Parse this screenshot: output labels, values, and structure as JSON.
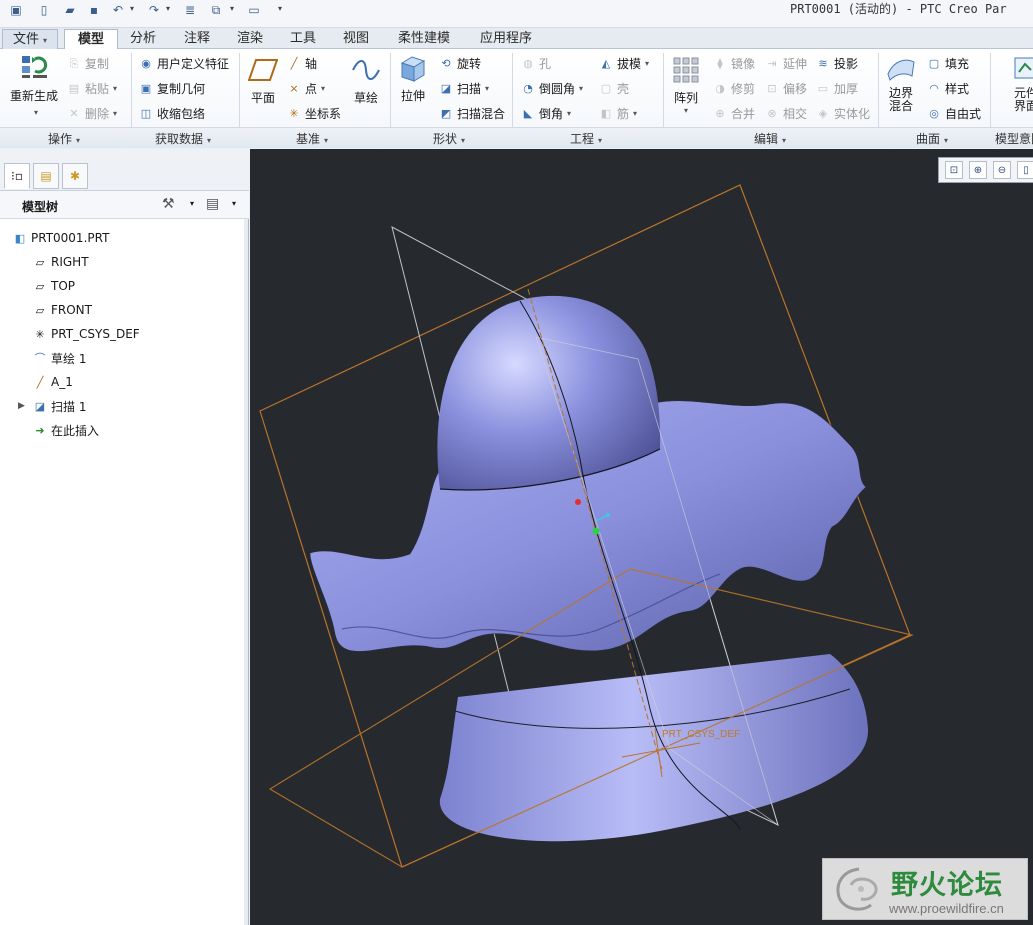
{
  "app": {
    "title": "PRT0001 (活动的) - PTC Creo Par"
  },
  "tabs": [
    {
      "label": "文件",
      "has_dropdown": true
    },
    {
      "label": "模型",
      "active": true
    },
    {
      "label": "分析"
    },
    {
      "label": "注释"
    },
    {
      "label": "渲染"
    },
    {
      "label": "工具"
    },
    {
      "label": "视图"
    },
    {
      "label": "柔性建模"
    },
    {
      "label": "应用程序"
    }
  ],
  "ribbon": {
    "operations": {
      "regenerate": "重新生成",
      "copy": "复制",
      "paste": "粘贴",
      "delete": "删除"
    },
    "get_data": {
      "udf": "用户定义特征",
      "copy_geom": "复制几何",
      "shrinkwrap": "收缩包络"
    },
    "datum": {
      "plane": "平面",
      "axis": "轴",
      "point": "点",
      "csys": "坐标系",
      "sketch": "草绘"
    },
    "shapes": {
      "extrude": "拉伸",
      "revolve": "旋转",
      "sweep": "扫描",
      "swept_blend": "扫描混合"
    },
    "engineering": {
      "hole": "孔",
      "draft": "拔模",
      "round": "倒圆角",
      "shell": "壳",
      "chamfer": "倒角",
      "rib": "筋"
    },
    "editing": {
      "pattern": "阵列",
      "mirror": "镜像",
      "extend": "延伸",
      "project": "投影",
      "trim": "修剪",
      "offset": "偏移",
      "thicken": "加厚",
      "merge": "合并",
      "intersect": "相交",
      "solidify": "实体化"
    },
    "surfaces": {
      "boundary_blend_1": "边界",
      "boundary_blend_2": "混合",
      "fill": "填充",
      "style": "样式",
      "freestyle": "自由式"
    },
    "model_intent": {
      "component_1": "元件",
      "component_2": "界面"
    },
    "groups": {
      "operations": "操作",
      "get_data": "获取数据",
      "datum": "基准",
      "shapes": "形状",
      "engineering": "工程",
      "editing": "编辑",
      "surfaces": "曲面",
      "model_intent": "模型意图"
    }
  },
  "tree": {
    "header": "模型树",
    "items": [
      {
        "label": "PRT0001.PRT",
        "icon": "part-icon"
      },
      {
        "label": "RIGHT",
        "icon": "datum-plane-icon"
      },
      {
        "label": "TOP",
        "icon": "datum-plane-icon"
      },
      {
        "label": "FRONT",
        "icon": "datum-plane-icon"
      },
      {
        "label": "PRT_CSYS_DEF",
        "icon": "csys-icon"
      },
      {
        "label": "草绘 1",
        "icon": "sketch-icon"
      },
      {
        "label": "A_1",
        "icon": "axis-icon"
      },
      {
        "label": "扫描 1",
        "icon": "sweep-icon",
        "expandable": true
      },
      {
        "label": "在此插入",
        "icon": "insert-here-icon"
      }
    ]
  },
  "viewport": {
    "csys_label": "PRT_CSYS_DEF",
    "model_color": "#8a90dc",
    "datum_color": "#c07a2a"
  },
  "watermark": {
    "text": "野火论坛",
    "url": "www.proewildfire.cn"
  }
}
